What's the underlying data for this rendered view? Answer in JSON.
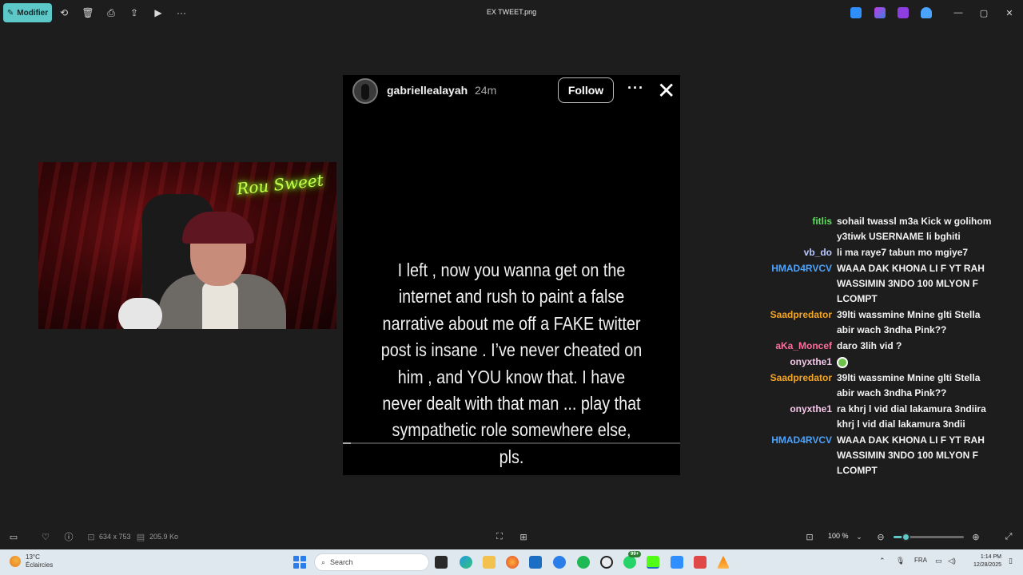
{
  "titlebar": {
    "edit_label": "Modifier",
    "file_title": "EX TWEET.png"
  },
  "story": {
    "username": "gabriellealayah",
    "age": "24m",
    "follow_label": "Follow",
    "more_icon": "···",
    "close_icon": "✕",
    "message": "I left ,  now you wanna get on the internet and rush to paint a false narrative about me off a FAKE twitter post is insane . I’ve never cheated on him , and YOU know that. I have never dealt with that man   ... play that sympathetic role somewhere else, pls."
  },
  "webcam": {
    "neon_sign": "Rou Sweet"
  },
  "chat": [
    {
      "nick": "fitlis",
      "color": "#59e25a",
      "text": "sohail twassl m3a Kick w golihom y3tiwk USERNAME li bghiti"
    },
    {
      "nick": "vb_do",
      "color": "#b9c7ff",
      "text": "li ma raye7 tabun mo mgiye7"
    },
    {
      "nick": "HMAD4RVCV",
      "color": "#4aa3ff",
      "text": "WAAA DAK KHONA LI F YT RAH WASSIMIN 3NDO 100 MLYON F LCOMPT"
    },
    {
      "nick": "Saadpredator",
      "color": "#f5a623",
      "text": "39lti wassmine Mnine glti Stella abir wach 3ndha Pink??"
    },
    {
      "nick": "aKa_Moncef",
      "color": "#ff6b9a",
      "text": "daro 3lih vid ?"
    },
    {
      "nick": "onyxthe1",
      "color": "#f4c6e8",
      "text": "",
      "emote": true
    },
    {
      "nick": "Saadpredator",
      "color": "#f5a623",
      "text": "39lti wassmine Mnine glti Stella abir wach 3ndha Pink??"
    },
    {
      "nick": "onyxthe1",
      "color": "#f4c6e8",
      "text": "ra khrj l vid dial lakamura 3ndiira khrj l vid dial lakamura 3ndii"
    },
    {
      "nick": "HMAD4RVCV",
      "color": "#4aa3ff",
      "text": "WAAA DAK KHONA LI F YT RAH WASSIMIN 3NDO 100 MLYON F LCOMPT"
    }
  ],
  "statusbar": {
    "dimensions": "634 x 753",
    "file_size": "205.9 Ko",
    "zoom": "100 %",
    "zoom_level": 0.17
  },
  "taskbar": {
    "temperature": "13°C",
    "weather": "Éclaircies",
    "search_placeholder": "Search",
    "badge": "99+",
    "lang": "FRA",
    "time": "1:14 PM",
    "date": "12/28/2025"
  },
  "colors": {
    "accent": "#5cc8c8",
    "background": "#1d1d1d"
  }
}
